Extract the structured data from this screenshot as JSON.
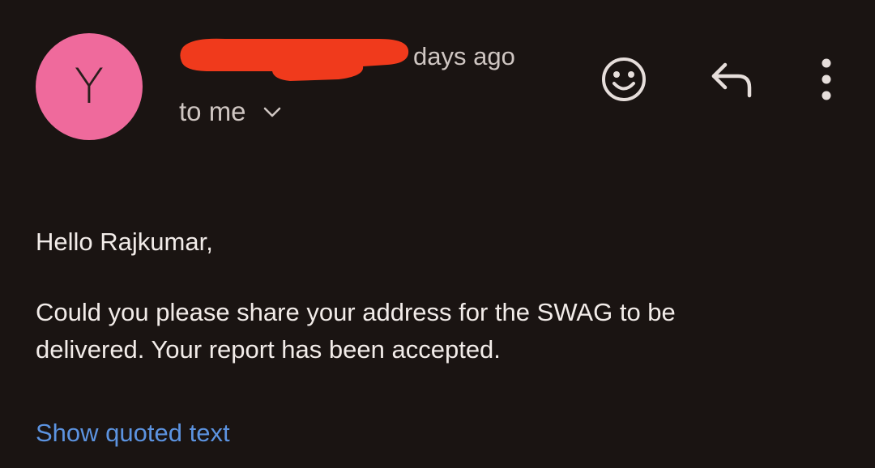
{
  "email": {
    "sender_initial": "Y",
    "time_ago": "days ago",
    "recipient_label": "to me",
    "greeting": "Hello Rajkumar,",
    "body_line1": "Could you please share your address for the SWAG to be",
    "body_line2": "delivered. Your report has been accepted.",
    "show_quoted_label": "Show quoted text"
  },
  "icons": {
    "react": "smiley-face-icon",
    "reply": "reply-arrow-icon",
    "more": "more-vertical-icon",
    "expand": "chevron-down-icon"
  },
  "colors": {
    "background": "#1a1412",
    "avatar": "#ef6a9c",
    "text_primary": "#f2ece9",
    "text_secondary": "#cfc6c2",
    "link": "#5c93e0",
    "redaction": "#f03a1c"
  }
}
